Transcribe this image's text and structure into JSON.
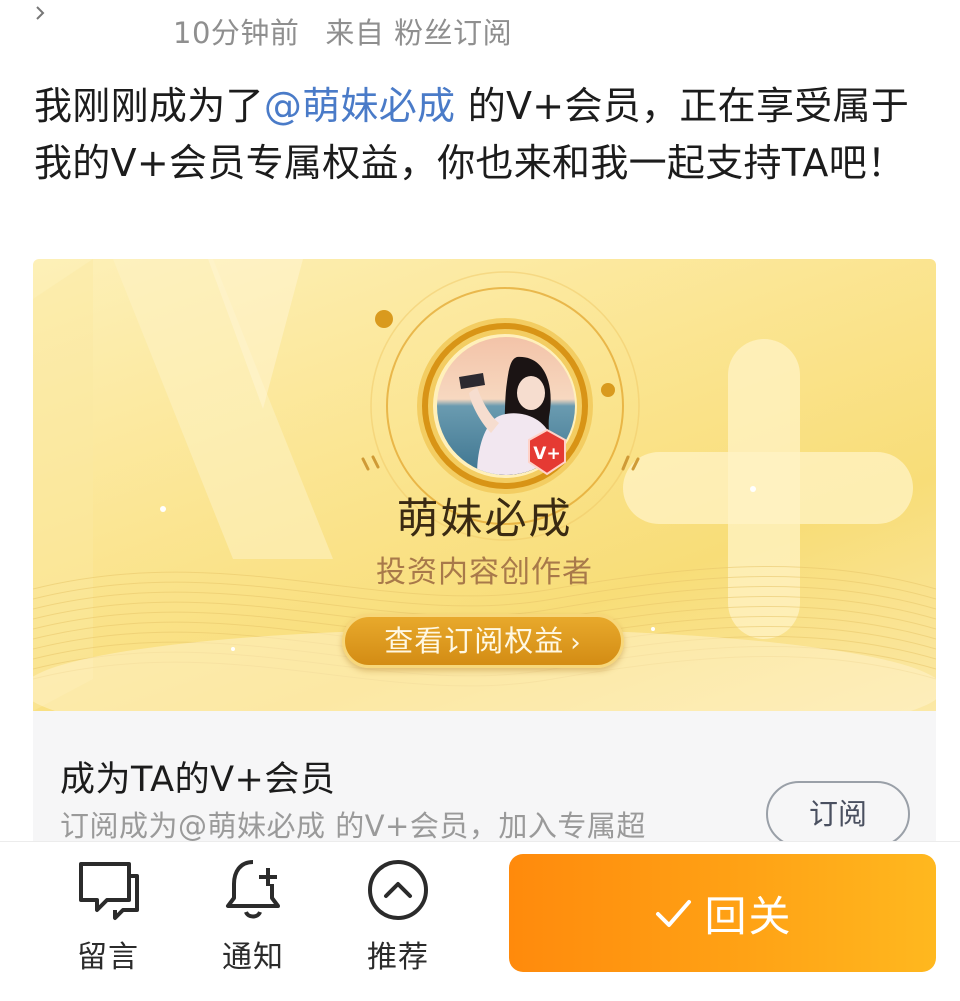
{
  "meta": {
    "time": "10分钟前",
    "source": "来自 粉丝订阅"
  },
  "post": {
    "before": "我刚刚成为了",
    "mention": "@萌妹必成",
    "after": " 的V+会员，正在享受属于我的V+会员专属权益，你也来和我一起支持TA吧！"
  },
  "card": {
    "name": "萌妹必成",
    "role": "投资内容创作者",
    "benefit_button": "查看订阅权益",
    "benefit_arrow": "›",
    "badge_text": "V+"
  },
  "subscribe": {
    "title": "成为TA的V+会员",
    "desc": "订阅成为@萌妹必成 的V+会员，加入专属超",
    "button": "订阅"
  },
  "toolbar": {
    "comment": "留言",
    "notify": "通知",
    "recommend": "推荐",
    "back": "回关"
  },
  "colors": {
    "accent_orange": "#ff9a10",
    "mention_blue": "#4a7bc8",
    "gold": "#d9951a"
  }
}
